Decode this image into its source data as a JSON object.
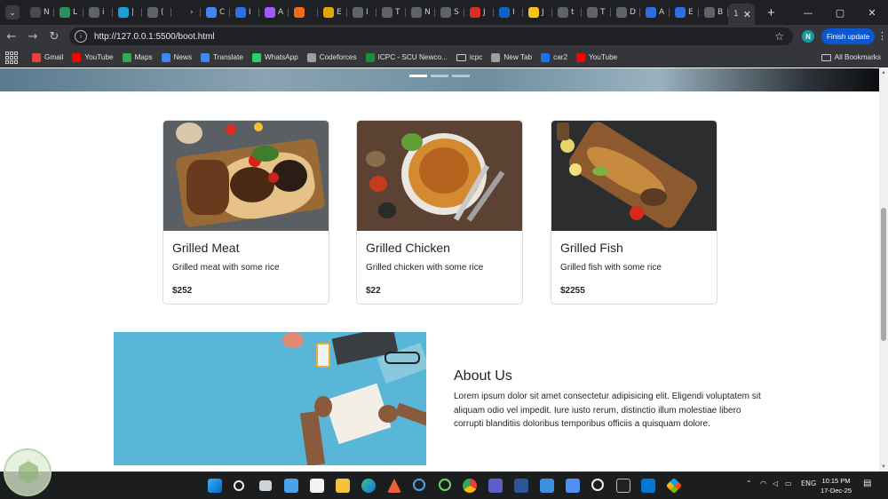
{
  "browser": {
    "tabs": [
      {
        "label": "N",
        "color": "#4a4b4f"
      },
      {
        "label": "L",
        "color": "#2d8f5c"
      },
      {
        "label": "i",
        "color": "#5f6368"
      },
      {
        "label": "|",
        "color": "#1b9fd6"
      },
      {
        "label": "(",
        "color": "#5f6368"
      },
      {
        "label": "›",
        "color": "#222"
      },
      {
        "label": "C",
        "color": "#4285f4"
      },
      {
        "label": "I",
        "color": "#2b6fe0"
      },
      {
        "label": "A",
        "color": "#a259ff"
      },
      {
        "label": "",
        "color": "#f06a1a"
      },
      {
        "label": "E",
        "color": "#e0a800"
      },
      {
        "label": "I",
        "color": "#5f6368"
      },
      {
        "label": "T",
        "color": "#5f6368"
      },
      {
        "label": "N",
        "color": "#5f6368"
      },
      {
        "label": "S",
        "color": "#5f6368"
      },
      {
        "label": "J",
        "color": "#d93025"
      },
      {
        "label": "I",
        "color": "#0a66c2"
      },
      {
        "label": "J",
        "color": "#f5c518"
      },
      {
        "label": "t",
        "color": "#5f6368"
      },
      {
        "label": "T",
        "color": "#5f6368"
      },
      {
        "label": "D",
        "color": "#5f6368"
      },
      {
        "label": "A",
        "color": "#2b6fe0"
      },
      {
        "label": "E",
        "color": "#2b6fe0"
      },
      {
        "label": "B",
        "color": "#5f6368"
      }
    ],
    "active_tab": {
      "label": "1"
    },
    "close_icon": "✕",
    "new_tab_icon": "+",
    "window_controls": {
      "minimize": "—",
      "maximize": "▢",
      "close": "✕"
    },
    "url": "http://127.0.0.1:5500/boot.html",
    "profile_initial": "N",
    "update_label": "Finish update",
    "bookmarks": [
      {
        "label": "Gmail",
        "color": "#ea4335"
      },
      {
        "label": "YouTube",
        "color": "#ff0000"
      },
      {
        "label": "Maps",
        "color": "#34a853"
      },
      {
        "label": "News",
        "color": "#4285f4"
      },
      {
        "label": "Translate",
        "color": "#4285f4"
      },
      {
        "label": "WhatsApp",
        "color": "#25d366"
      },
      {
        "label": "Codeforces",
        "color": "#9aa0a6"
      },
      {
        "label": "ICPC - SCU Newco...",
        "color": "#1e8e3e"
      },
      {
        "label": "icpc",
        "color": "folder"
      },
      {
        "label": "New Tab",
        "color": "#9aa0a6"
      },
      {
        "label": "car2",
        "color": "#1a73e8"
      },
      {
        "label": "YouTube",
        "color": "#ff0000"
      }
    ],
    "all_bookmarks_label": "All Bookmarks"
  },
  "cards": [
    {
      "title": "Grilled Meat",
      "text": "Grilled meat with some rice",
      "price": "$252"
    },
    {
      "title": "Grilled Chicken",
      "text": "Grilled chicken with some rice",
      "price": "$22"
    },
    {
      "title": "Grilled Fish",
      "text": "Grilled fish with some rice",
      "price": "$2255"
    }
  ],
  "about": {
    "title": "About Us",
    "text": "Lorem ipsum dolor sit amet consectetur adipisicing elit. Eligendi voluptatem sit aliquam odio vel impedit. Iure iusto rerum, distinctio illum molestiae libero corrupti blanditiis doloribus temporibus officiis a quisquam dolore."
  },
  "taskbar": {
    "tray_language": "ENG",
    "time": "10:15 PM",
    "date": "17-Dec-25"
  }
}
